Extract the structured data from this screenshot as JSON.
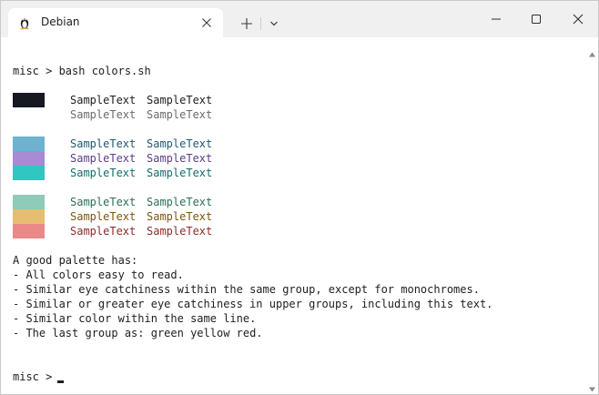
{
  "tab": {
    "title": "Debian",
    "icon": "linux-tux-icon"
  },
  "terminal": {
    "command_line": "misc > bash colors.sh",
    "samples": [
      {
        "swatch": "#16191f",
        "color1": "#1e1e1e",
        "color2": "#1e1e1e",
        "text1": "SampleText",
        "text2": "SampleText"
      },
      {
        "swatch": "#ffffff",
        "color1": "#6b6b6b",
        "color2": "#6b6b6b",
        "text1": "SampleText",
        "text2": "SampleText"
      },
      {
        "swatch": "#6db3cf",
        "color1": "#1f5a6e",
        "color2": "#1f5a6e",
        "text1": "SampleText",
        "text2": "SampleText"
      },
      {
        "swatch": "#a98bd4",
        "color1": "#5b3e86",
        "color2": "#5b3e86",
        "text1": "SampleText",
        "text2": "SampleText"
      },
      {
        "swatch": "#30c6c2",
        "color1": "#136d6a",
        "color2": "#136d6a",
        "text1": "SampleText",
        "text2": "SampleText"
      },
      {
        "swatch": "#8ecbb8",
        "color1": "#2d6e58",
        "color2": "#2d6e58",
        "text1": "SampleText",
        "text2": "SampleText"
      },
      {
        "swatch": "#e6bd72",
        "color1": "#7a5610",
        "color2": "#7a5610",
        "text1": "SampleText",
        "text2": "SampleText"
      },
      {
        "swatch": "#ea8987",
        "color1": "#8a2b2b",
        "color2": "#8a2b2b",
        "text1": "SampleText",
        "text2": "SampleText"
      }
    ],
    "notes": [
      "A good palette has:",
      "- All colors easy to read.",
      "- Similar eye catchiness within the same group, except for monochromes.",
      "- Similar or greater eye catchiness in upper groups, including this text.",
      "- Similar color within the same line.",
      "- The last group as: green yellow red."
    ],
    "prompt": "misc > "
  },
  "colors": {
    "titlebar_bg": "#f0f0f0",
    "terminal_bg": "#ffffff",
    "text": "#1e1e1e"
  }
}
